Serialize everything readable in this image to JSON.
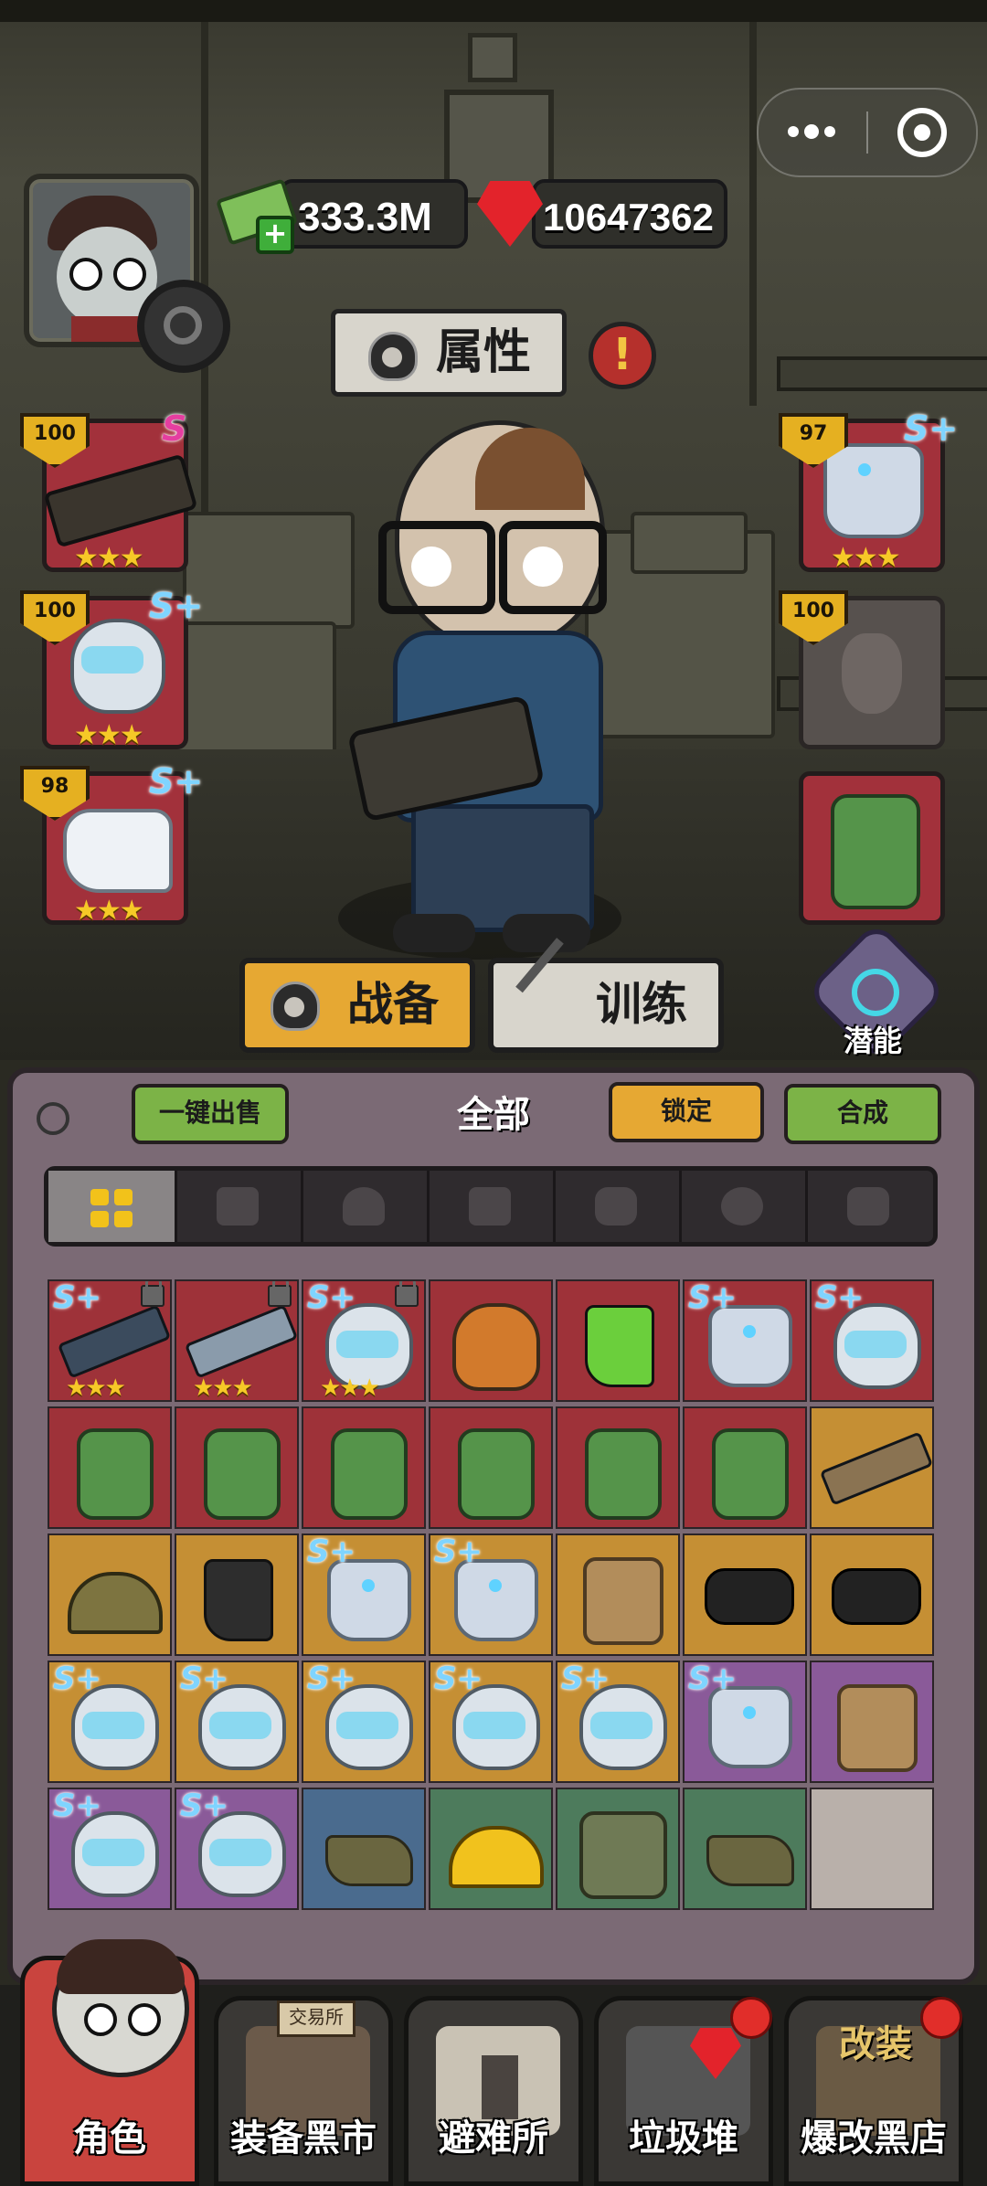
{
  "currency": {
    "cash": "333.3M",
    "gems": "10647362"
  },
  "attribute_button": {
    "label": "属性",
    "alert": "!"
  },
  "equipped_left": [
    {
      "level": "100",
      "grade": "S",
      "stars": "★★★"
    },
    {
      "level": "100",
      "grade": "S+",
      "stars": "★★★"
    },
    {
      "level": "98",
      "grade": "S+",
      "stars": "★★★"
    }
  ],
  "equipped_right": [
    {
      "level": "97",
      "grade": "S+",
      "stars": "★★★"
    },
    {
      "level": "100"
    }
  ],
  "main_tabs": {
    "gear": "战备",
    "train": "训练",
    "potential": "潜能"
  },
  "inventory": {
    "sell_all": "一键出售",
    "category": "全部",
    "lock": "锁定",
    "merge": "合成"
  },
  "grid_grades": {
    "splus": "S+",
    "stars": "★★★"
  },
  "nav": {
    "role": "角色",
    "black_market": "装备黑市",
    "shelter": "避难所",
    "junk": "垃圾堆",
    "mod_shop": "爆改黑店",
    "trade_sign": "交易所",
    "mod_sign": "改装"
  },
  "colors": {
    "rarity_red": "#9e3239",
    "rarity_gold": "#c58f34",
    "rarity_purple": "#8a5a99",
    "rarity_blue": "#4a6b8e",
    "rarity_green": "#4d7b5c",
    "level_badge": "#e5b021",
    "star": "#f6c927"
  }
}
